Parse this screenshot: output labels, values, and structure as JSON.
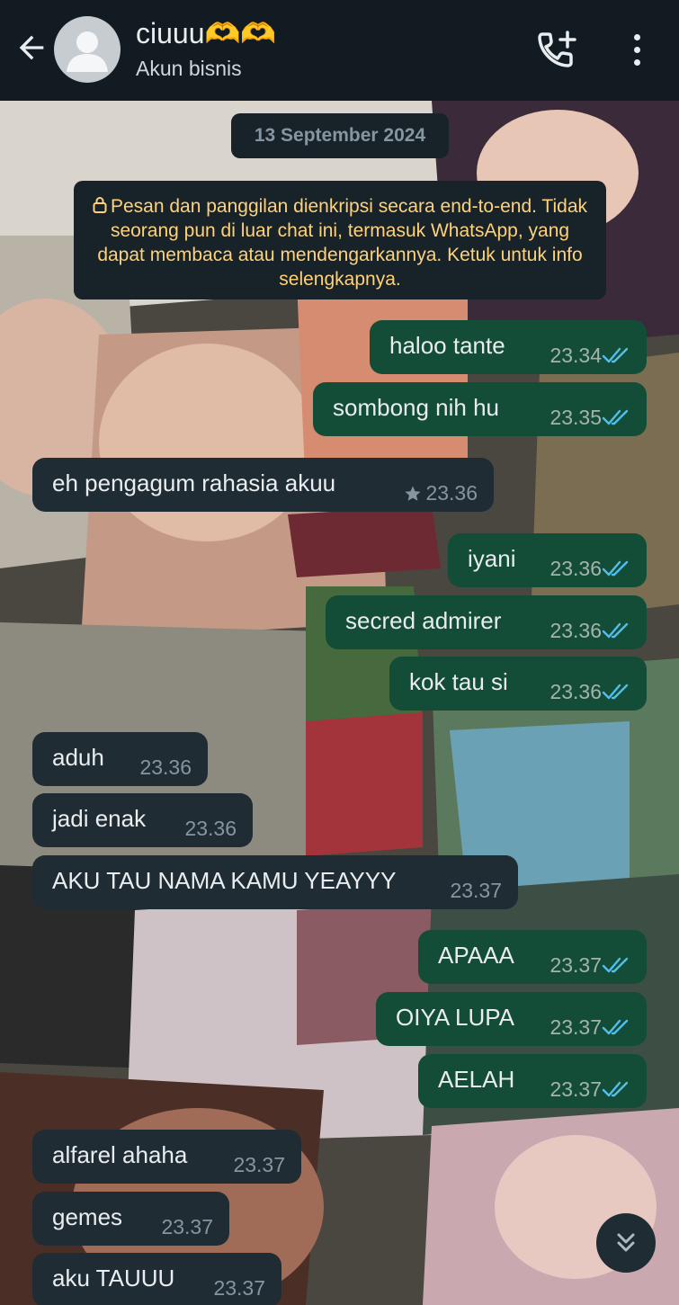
{
  "header": {
    "contact_name": "ciuuu🫶🫶",
    "subtitle": "Akun bisnis",
    "back_icon": "arrow-back-icon",
    "avatar_icon": "default-avatar-icon",
    "add_call_icon": "add-call-icon",
    "menu_icon": "more-vert-icon"
  },
  "chat": {
    "date": "13 September 2024",
    "encryption_notice": "Pesan dan panggilan dienkripsi secara end-to-end. Tidak seorang pun di luar chat ini, termasuk WhatsApp, yang dapat membaca atau mendengarkannya. Ketuk untuk info selengkapnya.",
    "messages": [
      {
        "dir": "out",
        "text": "haloo tante",
        "time": "23.34",
        "status": "read"
      },
      {
        "dir": "out",
        "text": "sombong nih hu",
        "time": "23.35",
        "status": "read"
      },
      {
        "dir": "in",
        "text": "eh pengagum rahasia akuu",
        "time": "23.36",
        "starred": true
      },
      {
        "dir": "out",
        "text": "iyani",
        "time": "23.36",
        "status": "read"
      },
      {
        "dir": "out",
        "text": "secred admirer",
        "time": "23.36",
        "status": "read"
      },
      {
        "dir": "out",
        "text": "kok tau si",
        "time": "23.36",
        "status": "read"
      },
      {
        "dir": "in",
        "text": "aduh",
        "time": "23.36"
      },
      {
        "dir": "in",
        "text": "jadi enak",
        "time": "23.36"
      },
      {
        "dir": "in",
        "text": "AKU TAU NAMA KAMU YEAYYY",
        "time": "23.37"
      },
      {
        "dir": "out",
        "text": "APAAA",
        "time": "23.37",
        "status": "read"
      },
      {
        "dir": "out",
        "text": "OIYA LUPA",
        "time": "23.37",
        "status": "read"
      },
      {
        "dir": "out",
        "text": "AELAH",
        "time": "23.37",
        "status": "read"
      },
      {
        "dir": "in",
        "text": "alfarel ahaha",
        "time": "23.37"
      },
      {
        "dir": "in",
        "text": "gemes",
        "time": "23.37"
      },
      {
        "dir": "in",
        "text": "aku TAUUU",
        "time": "23.37"
      }
    ],
    "scroll_icon": "double-chevron-down-icon"
  },
  "colors": {
    "header_bg": "#111b21",
    "outgoing_bubble": "#144d37",
    "incoming_bubble": "#202c33",
    "notice_text": "#ffd279",
    "read_ticks": "#53bdeb"
  }
}
